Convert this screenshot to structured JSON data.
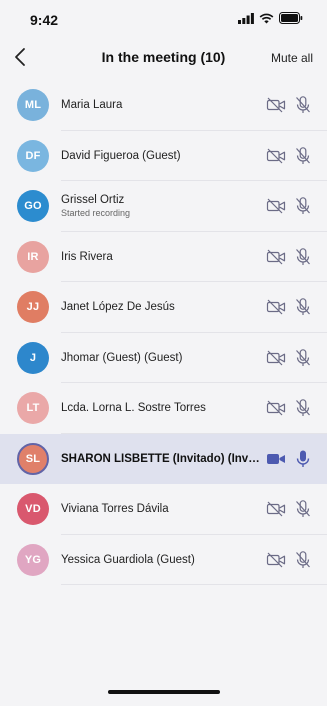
{
  "status_bar": {
    "time": "9:42"
  },
  "header": {
    "title": "In the meeting (10)",
    "mute_all_label": "Mute all"
  },
  "colors": {
    "accent": "#6264a7",
    "icon_muted": "#6b6b86",
    "icon_active": "#4d5ab0"
  },
  "participants": [
    {
      "initials": "ML",
      "name": "Maria Laura",
      "subtitle": "",
      "avatar_color": "#79b2dc",
      "active": false
    },
    {
      "initials": "DF",
      "name": "David Figueroa (Guest)",
      "subtitle": "",
      "avatar_color": "#7ab6e0",
      "active": false
    },
    {
      "initials": "GO",
      "name": "Grissel Ortiz",
      "subtitle": "Started recording",
      "avatar_color": "#2c8ccf",
      "active": false
    },
    {
      "initials": "IR",
      "name": "Iris Rivera",
      "subtitle": "",
      "avatar_color": "#e8a3a0",
      "active": false
    },
    {
      "initials": "JJ",
      "name": "Janet López De Jesús",
      "subtitle": "",
      "avatar_color": "#e07d63",
      "active": false
    },
    {
      "initials": "J",
      "name": "Jhomar (Guest) (Guest)",
      "subtitle": "",
      "avatar_color": "#2d87cc",
      "active": false
    },
    {
      "initials": "LT",
      "name": "Lcda. Lorna L. Sostre Torres",
      "subtitle": "",
      "avatar_color": "#eaa8a8",
      "active": false
    },
    {
      "initials": "SL",
      "name": "SHARON LISBETTE (Invitado) (Invitado)",
      "subtitle": "",
      "avatar_color": "#e0806a",
      "active": true
    },
    {
      "initials": "VD",
      "name": "Viviana Torres Dávila",
      "subtitle": "",
      "avatar_color": "#d9586e",
      "active": false
    },
    {
      "initials": "YG",
      "name": "Yessica Guardiola (Guest)",
      "subtitle": "",
      "avatar_color": "#e0a6c2",
      "active": false
    }
  ]
}
